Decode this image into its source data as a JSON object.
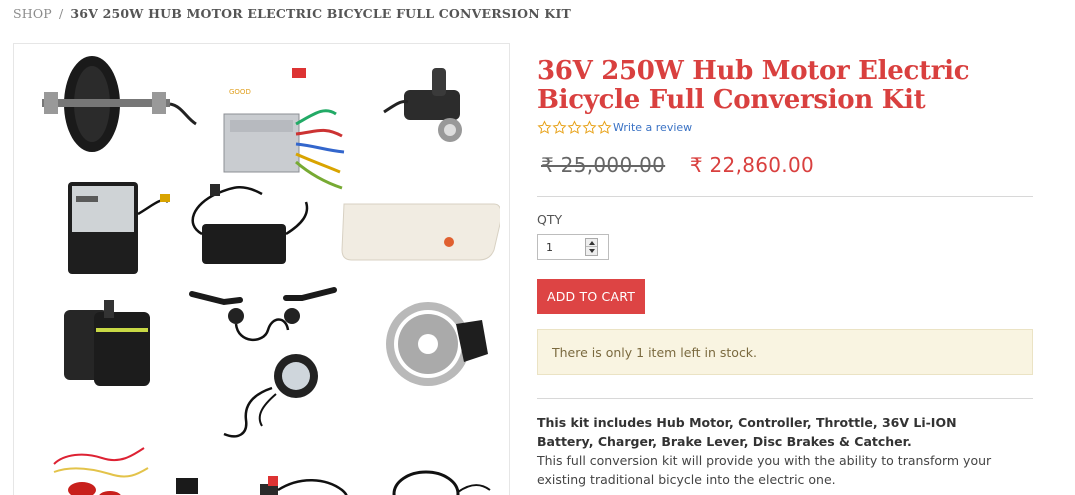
{
  "breadcrumb": {
    "shop": "SHOP",
    "separator": "/",
    "current": "36V 250W HUB MOTOR ELECTRIC BICYCLE FULL CONVERSION KIT"
  },
  "gallery": {
    "images": [
      "hub-motor",
      "controller",
      "throttle",
      "battery",
      "charger",
      "battery-case",
      "pannier-bag",
      "brake-levers",
      "disc-brake",
      "headlight",
      "wiring-harness",
      "switch",
      "tail-light"
    ]
  },
  "product": {
    "title": "36V 250W Hub Motor Electric Bicycle Full Conversion Kit",
    "rating": 0,
    "star_count": 5,
    "review_link": "Write a review",
    "old_price": "₹ 25,000.00",
    "new_price": "₹ 22,860.00"
  },
  "purchase": {
    "qty_label": "QTY",
    "qty_value": "1",
    "add_to_cart": "ADD TO CART",
    "stock_notice": "There is only 1 item left in stock."
  },
  "description": {
    "bold_text": "This kit includes Hub Motor, Controller, Throttle, 36V Li-ION Battery, Charger, Brake Lever, Disc Brakes & Catcher.",
    "body_text": "This full conversion kit will provide you with the ability to transform your existing traditional bicycle into the electric one."
  },
  "colors": {
    "accent": "#d9403f",
    "button": "#dd4444",
    "star": "#e8a31c",
    "link": "#3a72c4",
    "notice_bg": "#f9f4e1"
  }
}
